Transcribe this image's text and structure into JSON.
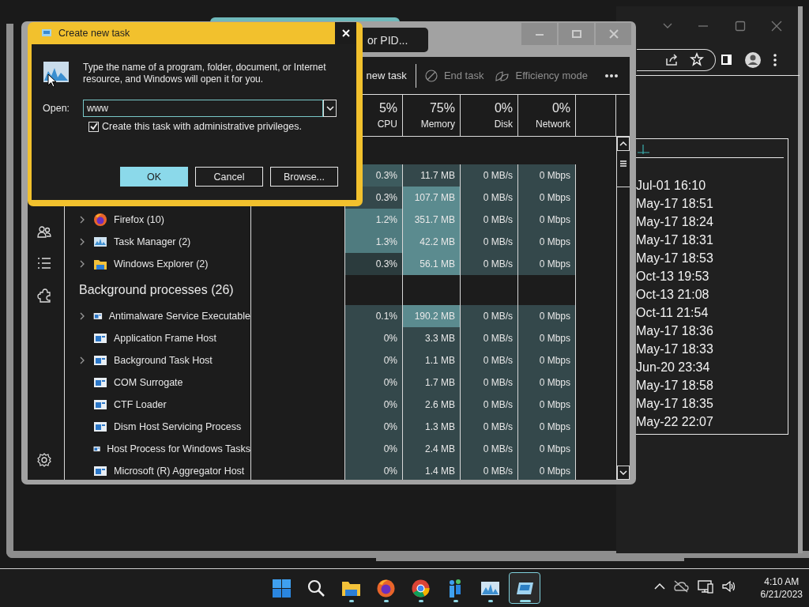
{
  "browser_window": {
    "history_times": [
      "Jul-01 16:10",
      "May-17 18:51",
      "May-17 18:24",
      "May-17 18:31",
      "May-17 18:53",
      "Oct-13 19:53",
      "Oct-13 21:08",
      "Oct-11 21:54",
      "May-17 18:36",
      "May-17 18:33",
      "Jun-20 23:34",
      "May-17 18:58",
      "May-17 18:35",
      "May-22 22:07"
    ]
  },
  "task_manager": {
    "search": {
      "placeholder": "or PID..."
    },
    "toolbar": [
      {
        "kind": "plain",
        "label": "new task"
      },
      {
        "kind": "end",
        "label": "End task"
      },
      {
        "kind": "leaf",
        "label": "Efficiency mode"
      }
    ],
    "columns": [
      {
        "percent": "5%",
        "label": "CPU"
      },
      {
        "percent": "75%",
        "label": "Memory"
      },
      {
        "percent": "0%",
        "label": "Disk"
      },
      {
        "percent": "0%",
        "label": "Network"
      }
    ],
    "rows": [
      {
        "kind": "hidden",
        "cells": [
          {
            "text": "0.3%",
            "color": "#3d5b5e"
          },
          {
            "text": "11.7 MB",
            "color": "#34484b"
          },
          {
            "text": "0 MB/s",
            "color": "#34484b"
          },
          {
            "text": "0 Mbps",
            "color": "#34484b"
          }
        ]
      },
      {
        "kind": "hidden",
        "cells": [
          {
            "text": "0.3%",
            "color": "#34484b"
          },
          {
            "text": "107.7 MB",
            "color": "#5b8b8f"
          },
          {
            "text": "0 MB/s",
            "color": "#34484b"
          },
          {
            "text": "0 Mbps",
            "color": "#34484b"
          }
        ]
      },
      {
        "kind": "firefox",
        "name": "Firefox (10)",
        "expandable": true,
        "cells": [
          {
            "text": "1.2%",
            "color": "#4f7b7f"
          },
          {
            "text": "351.7 MB",
            "color": "#5b8b8f"
          },
          {
            "text": "0 MB/s",
            "color": "#34484b"
          },
          {
            "text": "0 Mbps",
            "color": "#34484b"
          }
        ]
      },
      {
        "kind": "chart",
        "name": "Task Manager (2)",
        "expandable": true,
        "cells": [
          {
            "text": "1.3%",
            "color": "#4f7b7f"
          },
          {
            "text": "42.2 MB",
            "color": "#5b8b8f"
          },
          {
            "text": "0 MB/s",
            "color": "#34484b"
          },
          {
            "text": "0 Mbps",
            "color": "#34484b"
          }
        ]
      },
      {
        "kind": "folder",
        "name": "Windows Explorer (2)",
        "expandable": true,
        "cells": [
          {
            "text": "0.3%",
            "color": "#2b3b3d"
          },
          {
            "text": "56.1 MB",
            "color": "#5b8b8f"
          },
          {
            "text": "0 MB/s",
            "color": "#34484b"
          },
          {
            "text": "0 Mbps",
            "color": "#34484b"
          }
        ]
      },
      {
        "kind": "heading",
        "name": "Background processes (26)"
      },
      {
        "kind": "app",
        "name": "Antimalware Service Executable",
        "expandable": true,
        "cells": [
          {
            "text": "0.1%",
            "color": "#34484b"
          },
          {
            "text": "190.2 MB",
            "color": "#5b8b8f"
          },
          {
            "text": "0 MB/s",
            "color": "#34484b"
          },
          {
            "text": "0 Mbps",
            "color": "#34484b"
          }
        ]
      },
      {
        "kind": "app",
        "name": "Application Frame Host",
        "expandable": false,
        "cells": [
          {
            "text": "0%",
            "color": "#34484b"
          },
          {
            "text": "3.3 MB",
            "color": "#34484b"
          },
          {
            "text": "0 MB/s",
            "color": "#34484b"
          },
          {
            "text": "0 Mbps",
            "color": "#34484b"
          }
        ]
      },
      {
        "kind": "app",
        "name": "Background Task Host",
        "expandable": true,
        "cells": [
          {
            "text": "0%",
            "color": "#34484b"
          },
          {
            "text": "1.1 MB",
            "color": "#34484b"
          },
          {
            "text": "0 MB/s",
            "color": "#34484b"
          },
          {
            "text": "0 Mbps",
            "color": "#34484b"
          }
        ]
      },
      {
        "kind": "app",
        "name": "COM Surrogate",
        "expandable": false,
        "cells": [
          {
            "text": "0%",
            "color": "#34484b"
          },
          {
            "text": "1.7 MB",
            "color": "#34484b"
          },
          {
            "text": "0 MB/s",
            "color": "#34484b"
          },
          {
            "text": "0 Mbps",
            "color": "#34484b"
          }
        ]
      },
      {
        "kind": "app",
        "name": "CTF Loader",
        "expandable": false,
        "cells": [
          {
            "text": "0%",
            "color": "#34484b"
          },
          {
            "text": "2.6 MB",
            "color": "#34484b"
          },
          {
            "text": "0 MB/s",
            "color": "#34484b"
          },
          {
            "text": "0 Mbps",
            "color": "#34484b"
          }
        ]
      },
      {
        "kind": "app",
        "name": "Dism Host Servicing Process",
        "expandable": false,
        "cells": [
          {
            "text": "0%",
            "color": "#34484b"
          },
          {
            "text": "1.3 MB",
            "color": "#34484b"
          },
          {
            "text": "0 MB/s",
            "color": "#34484b"
          },
          {
            "text": "0 Mbps",
            "color": "#34484b"
          }
        ]
      },
      {
        "kind": "app",
        "name": "Host Process for Windows Tasks",
        "expandable": false,
        "cells": [
          {
            "text": "0%",
            "color": "#34484b"
          },
          {
            "text": "2.4 MB",
            "color": "#34484b"
          },
          {
            "text": "0 MB/s",
            "color": "#34484b"
          },
          {
            "text": "0 Mbps",
            "color": "#34484b"
          }
        ]
      },
      {
        "kind": "app",
        "name": "Microsoft (R) Aggregator Host",
        "expandable": false,
        "cells": [
          {
            "text": "0%",
            "color": "#34484b"
          },
          {
            "text": "1.4 MB",
            "color": "#34484b"
          },
          {
            "text": "0 MB/s",
            "color": "#34484b"
          },
          {
            "text": "0 Mbps",
            "color": "#34484b"
          }
        ]
      }
    ]
  },
  "dialog": {
    "title": "Create new task",
    "description": "Type the name of a program, folder, document, or Internet resource, and Windows will open it for you.",
    "open_label": "Open:",
    "open_value": "www",
    "admin": {
      "label": "Create this task with administrative privileges.",
      "checked": true
    },
    "buttons": [
      {
        "label": "OK",
        "default": true
      },
      {
        "label": "Cancel",
        "default": false
      },
      {
        "label": "Browse...",
        "default": false
      }
    ]
  },
  "taskbar": {
    "apps": [
      {
        "kind": "start",
        "running": false,
        "active": false
      },
      {
        "kind": "search",
        "running": false,
        "active": false
      },
      {
        "kind": "folder",
        "running": true,
        "active": false
      },
      {
        "kind": "firefox",
        "running": true,
        "active": false
      },
      {
        "kind": "chrome",
        "running": true,
        "active": false
      },
      {
        "kind": "people",
        "running": true,
        "active": false
      },
      {
        "kind": "chart",
        "running": true,
        "active": false
      },
      {
        "kind": "window",
        "running": true,
        "active": true
      }
    ],
    "time": "4:10 AM",
    "date": "6/21/2023"
  }
}
